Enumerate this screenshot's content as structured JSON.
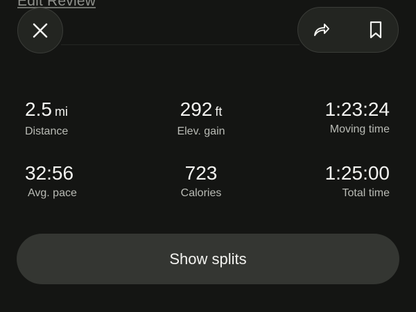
{
  "header": {
    "edit_review_label": "Edit Review",
    "close_icon": "close-icon",
    "share_icon": "share-icon",
    "bookmark_icon": "bookmark-icon"
  },
  "stats": {
    "distance": {
      "value": "2.5",
      "unit": "mi",
      "label": "Distance"
    },
    "elevation": {
      "value": "292",
      "unit": "ft",
      "label": "Elev. gain"
    },
    "moving_time": {
      "value": "1:23:24",
      "label": "Moving time"
    },
    "avg_pace": {
      "value": "32:56",
      "label": "Avg. pace"
    },
    "calories": {
      "value": "723",
      "label": "Calories"
    },
    "total_time": {
      "value": "1:25:00",
      "label": "Total time"
    }
  },
  "splits_button_label": "Show splits",
  "colors": {
    "background": "#141513",
    "button": "#343632",
    "text": "#f3f3f0",
    "muted_text": "#b9bbb5"
  }
}
